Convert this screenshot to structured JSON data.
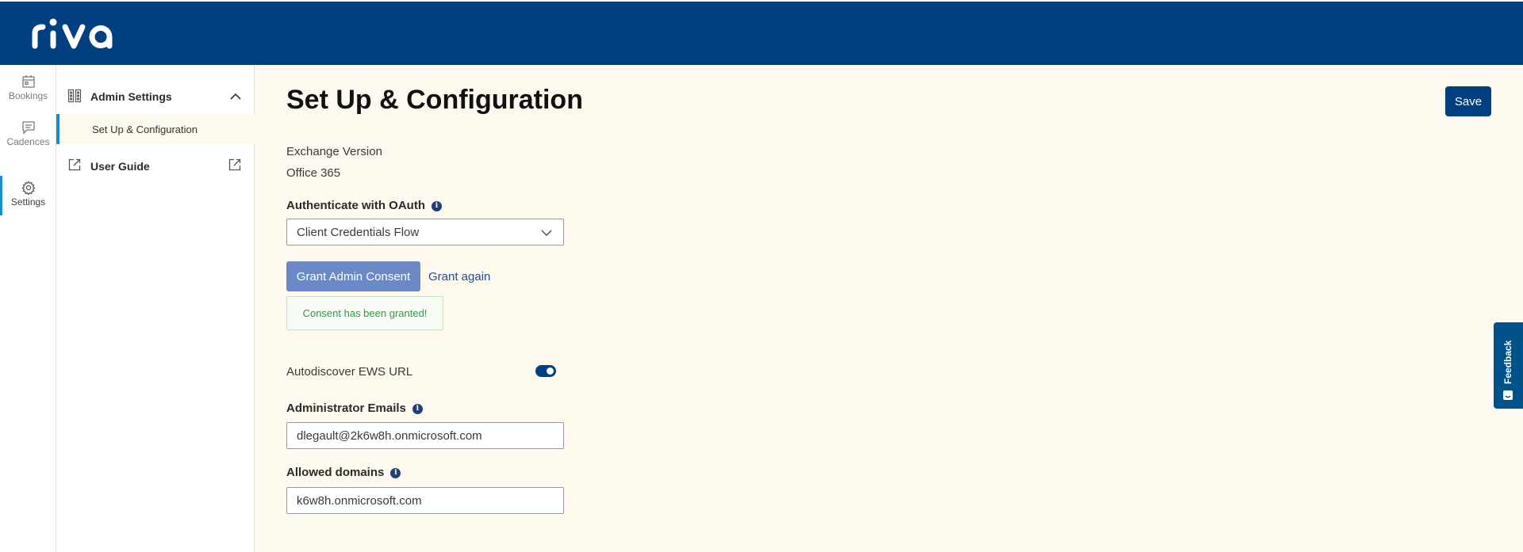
{
  "brand": {
    "logo_text": "riva",
    "topbar_color": "#003f80",
    "accent": "#1a8fc7"
  },
  "rail": {
    "items": [
      {
        "label": "Bookings",
        "icon": "calendar-icon"
      },
      {
        "label": "Cadences",
        "icon": "comment-icon"
      },
      {
        "label": "Settings",
        "icon": "gear-icon",
        "active": true
      }
    ]
  },
  "subnav": {
    "section_label": "Admin Settings",
    "section_icon": "settings-panel-icon",
    "sub_item": "Set Up & Configuration",
    "guide_label": "User Guide",
    "guide_icon": "external-link-icon"
  },
  "main": {
    "title": "Set Up & Configuration",
    "save_label": "Save",
    "exchange_version_label": "Exchange Version",
    "exchange_version_value": "Office 365",
    "oauth_label": "Authenticate with OAuth",
    "oauth_value": "Client Credentials Flow",
    "grant_button": "Grant Admin Consent",
    "grant_again": "Grant again",
    "consent_message": "Consent has been granted!",
    "autodiscover_label": "Autodiscover EWS URL",
    "autodiscover_on": true,
    "admin_emails_label": "Administrator Emails",
    "admin_emails_value": "dlegault@2k6w8h.onmicrosoft.com",
    "allowed_domains_label": "Allowed domains",
    "allowed_domains_value": "k6w8h.onmicrosoft.com",
    "info_symbol": "i"
  },
  "feedback": {
    "label": "Feedback"
  }
}
